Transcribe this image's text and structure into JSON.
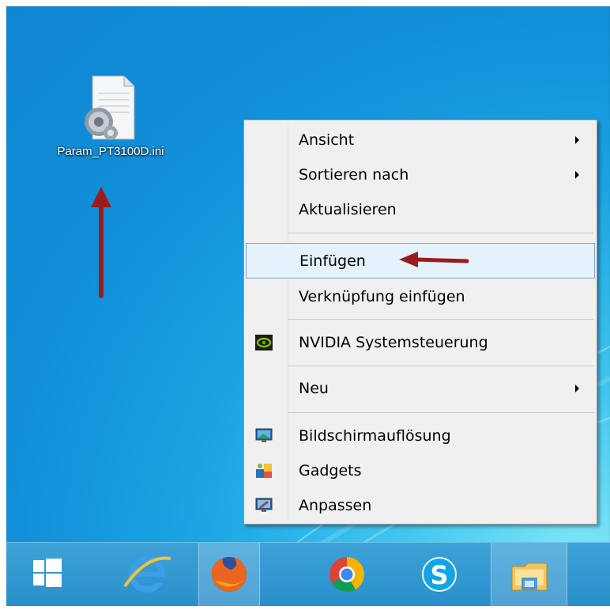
{
  "desktop": {
    "file_icon": {
      "label": "Param_PT3100D.ini",
      "icon": "ini-settings-file-icon"
    }
  },
  "context_menu": {
    "items": [
      {
        "label": "Ansicht",
        "submenu": true
      },
      {
        "label": "Sortieren nach",
        "submenu": true
      },
      {
        "label": "Aktualisieren"
      },
      {
        "label": "Einfügen",
        "highlighted": true
      },
      {
        "label": "Verknüpfung einfügen"
      },
      {
        "label": "NVIDIA Systemsteuerung",
        "icon": "nvidia-icon"
      },
      {
        "label": "Neu",
        "submenu": true
      },
      {
        "label": "Bildschirmauflösung",
        "icon": "display-resolution-icon"
      },
      {
        "label": "Gadgets",
        "icon": "gadgets-icon"
      },
      {
        "label": "Anpassen",
        "icon": "personalize-icon"
      }
    ]
  },
  "taskbar": {
    "items": [
      {
        "name": "windows-start-icon"
      },
      {
        "name": "internet-explorer-icon"
      },
      {
        "name": "firefox-icon",
        "active": true
      },
      {
        "name": "chrome-icon"
      },
      {
        "name": "skype-icon"
      },
      {
        "name": "file-explorer-icon",
        "active": true
      }
    ]
  },
  "colors": {
    "annotation_arrow": "#9b1c1c",
    "taskbar": "#2f96cf",
    "highlight": "#e5f1fb"
  }
}
